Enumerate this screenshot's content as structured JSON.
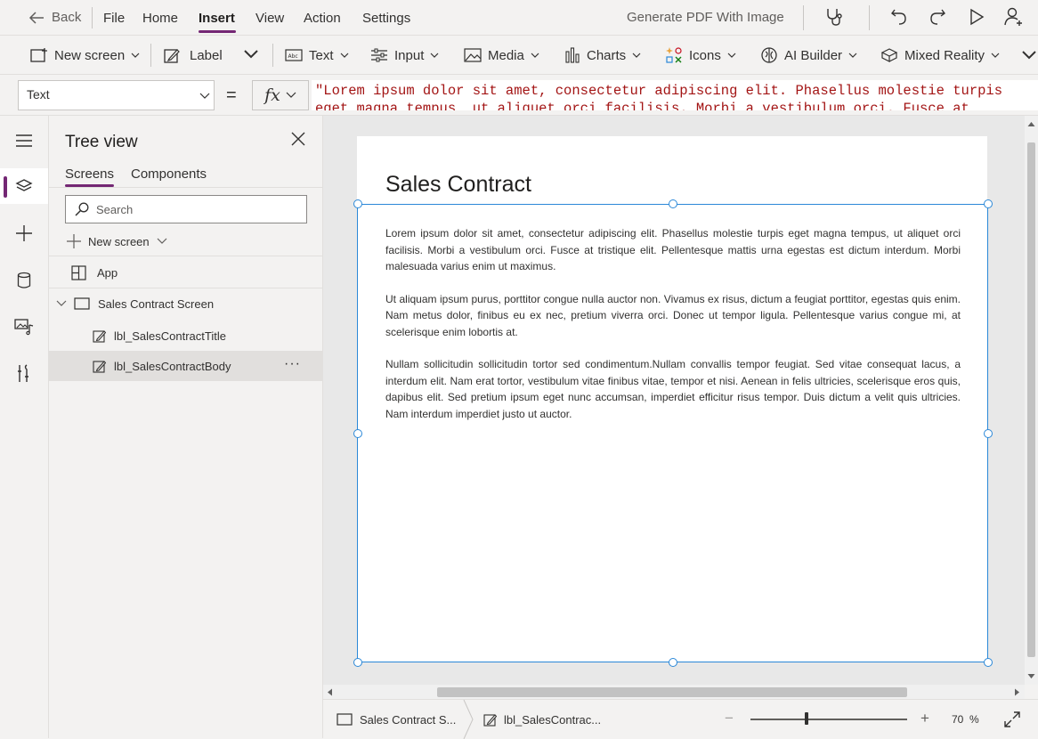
{
  "menu": {
    "back": "Back",
    "items": [
      "File",
      "Home",
      "Insert",
      "View",
      "Action",
      "Settings"
    ],
    "active": "Insert",
    "app_name": "Generate PDF With Image"
  },
  "ribbon": {
    "new_screen": "New screen",
    "label": "Label",
    "text": "Text",
    "input": "Input",
    "media": "Media",
    "charts": "Charts",
    "icons": "Icons",
    "ai_builder": "AI Builder",
    "mixed_reality": "Mixed Reality"
  },
  "formula_bar": {
    "property": "Text",
    "equals": "=",
    "fx": "fx",
    "formula": "\"Lorem ipsum dolor sit amet, consectetur adipiscing elit. Phasellus molestie turpis eget magna tempus, ut aliquet orci facilisis. Morbi a vestibulum orci. Fusce at tristique"
  },
  "tree_view": {
    "title": "Tree view",
    "tabs": [
      "Screens",
      "Components"
    ],
    "active_tab": "Screens",
    "search_placeholder": "Search",
    "new_screen": "New screen",
    "app": "App",
    "screen": "Sales Contract Screen",
    "controls": [
      "lbl_SalesContractTitle",
      "lbl_SalesContractBody"
    ],
    "selected": "lbl_SalesContractBody",
    "more": "···"
  },
  "canvas": {
    "title": "Sales Contract",
    "body": [
      "Lorem ipsum dolor sit amet, consectetur adipiscing elit. Phasellus molestie turpis eget magna tempus, ut aliquet orci facilisis. Morbi a vestibulum orci. Fusce at tristique elit. Pellentesque mattis urna egestas est dictum interdum. Morbi malesuada varius enim ut maximus.",
      "Ut aliquam ipsum purus, porttitor congue nulla auctor non. Vivamus ex risus, dictum a feugiat porttitor, egestas quis enim. Nam metus dolor, finibus eu ex nec, pretium viverra orci. Donec ut tempor ligula. Pellentesque varius congue mi, at scelerisque enim lobortis at.",
      "Nullam sollicitudin sollicitudin tortor sed condimentum.Nullam convallis tempor feugiat. Sed vitae consequat lacus, a interdum elit. Nam erat tortor, vestibulum vitae finibus vitae, tempor et nisi. Aenean in felis ultricies, scelerisque eros quis, dapibus elit. Sed pretium ipsum eget nunc accumsan, imperdiet efficitur risus tempor. Duis dictum a velit quis ultricies. Nam interdum imperdiet justo ut auctor."
    ]
  },
  "status": {
    "screen_crumb": "Sales Contract S...",
    "control_crumb": "lbl_SalesContrac...",
    "zoom_minus": "−",
    "zoom_plus": "+",
    "zoom": "70",
    "zoom_unit": "%",
    "zoom_fraction": 0.36
  },
  "colors": {
    "accent": "#742774",
    "selection": "#2b88d8",
    "formula_text": "#a31515"
  }
}
